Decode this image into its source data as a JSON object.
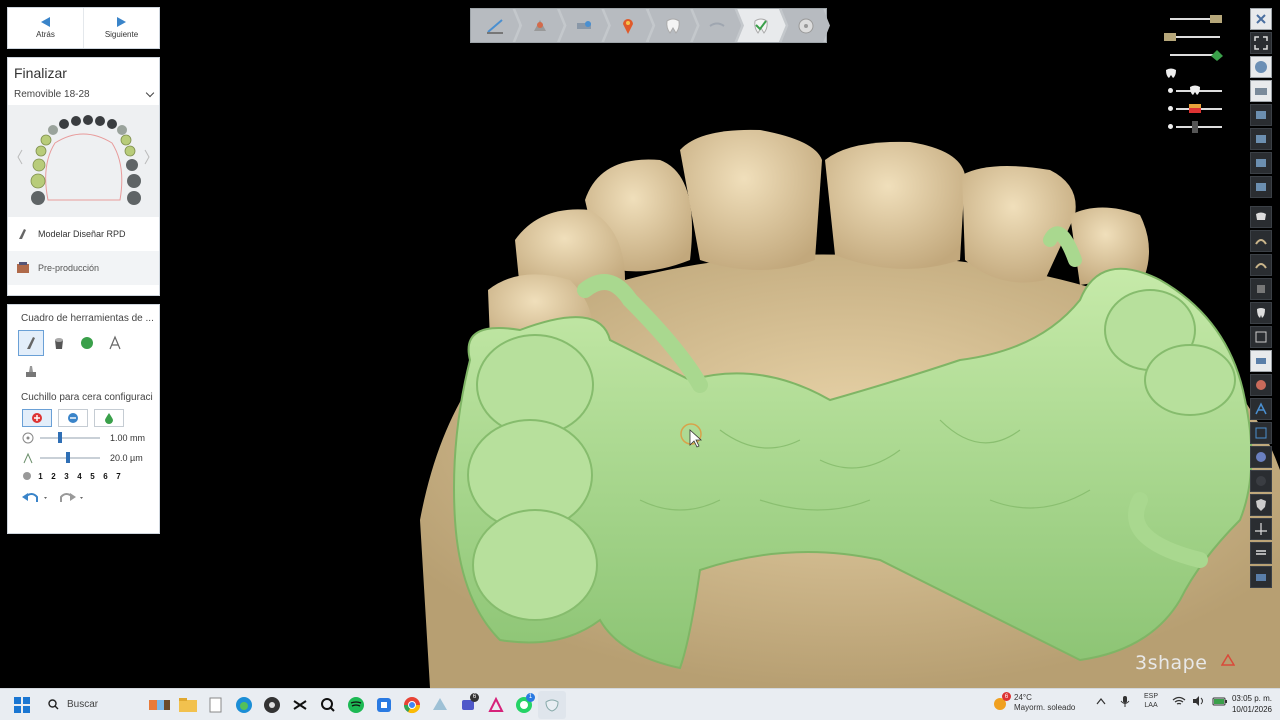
{
  "nav": {
    "back_label": "Atrás",
    "next_label": "Siguiente"
  },
  "finish": {
    "title": "Finalizar",
    "selection": "Removible 18-28",
    "steps": [
      {
        "label": "Modelar Diseñar RPD"
      },
      {
        "label": "Pre-producción"
      }
    ]
  },
  "tools": {
    "toolbox_title": "Cuadro de herramientas de ...",
    "knife_title": "Cuchillo para cera configuraci",
    "size_value": "1.00 mm",
    "thickness_value": "20.0 µm",
    "numbers": [
      "1",
      "2",
      "3",
      "4",
      "5",
      "6",
      "7"
    ]
  },
  "toolbar": {
    "icons": [
      "margin-tool-icon",
      "scan-tool-icon",
      "pontic-tool-icon",
      "pin-tool-icon",
      "tooth-tool-icon",
      "clasp-tool-icon",
      "framework-tool-icon",
      "finish-tool-icon"
    ],
    "active_index": 6
  },
  "brand": {
    "text": "3shape"
  },
  "taskbar": {
    "search_placeholder": "Buscar",
    "weather_badge": "6",
    "temperature": "24°C",
    "weather_desc": "Mayorm. soleado",
    "language": "ESP",
    "layout": "LAA",
    "time": "03:05 p. m.",
    "date": "10/01/2026",
    "badges": {
      "teams": "6",
      "whatsapp": "1"
    }
  },
  "colors": {
    "framework_green": "#a9d88f",
    "tooth_tan": "#d9c39a",
    "accent_blue": "#3a84c9"
  }
}
